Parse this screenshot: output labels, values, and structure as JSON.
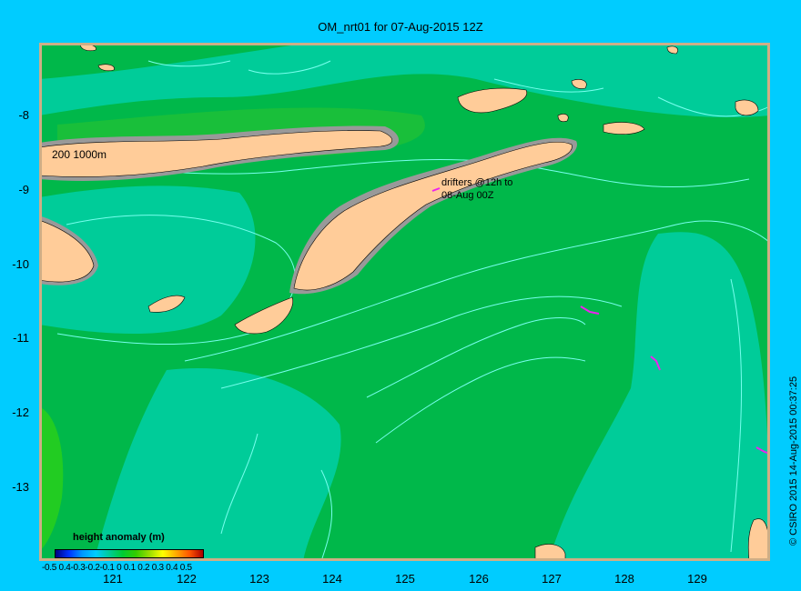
{
  "title": "OM_nrt01 for 07-Aug-2015 12Z",
  "credit": "© CSIRO 2015   14-Aug-2015 00:37:25",
  "map_labels": {
    "isobath": "200  1000m",
    "drifters_line1": "drifters @12h to",
    "drifters_line2": "08-Aug 00Z"
  },
  "colorbar": {
    "title": "height anomaly (m)",
    "tick_labels": "-0.5 0.4-0.3-0.2-0.1  0  0.1 0.2 0.3 0.4 0.5"
  },
  "axes": {
    "y_ticks": [
      "-8",
      "-9",
      "-10",
      "-11",
      "-12",
      "-13"
    ],
    "x_ticks": [
      "121",
      "122",
      "123",
      "124",
      "125",
      "126",
      "127",
      "128",
      "129"
    ]
  },
  "colors": {
    "background": "#00ccff",
    "sea_green": "#00b84a",
    "sea_teal": "#00cc99",
    "land": "#ffcc99",
    "shelf": "#999999",
    "contour": "#77ffee",
    "drifter": "#ee22ee"
  }
}
